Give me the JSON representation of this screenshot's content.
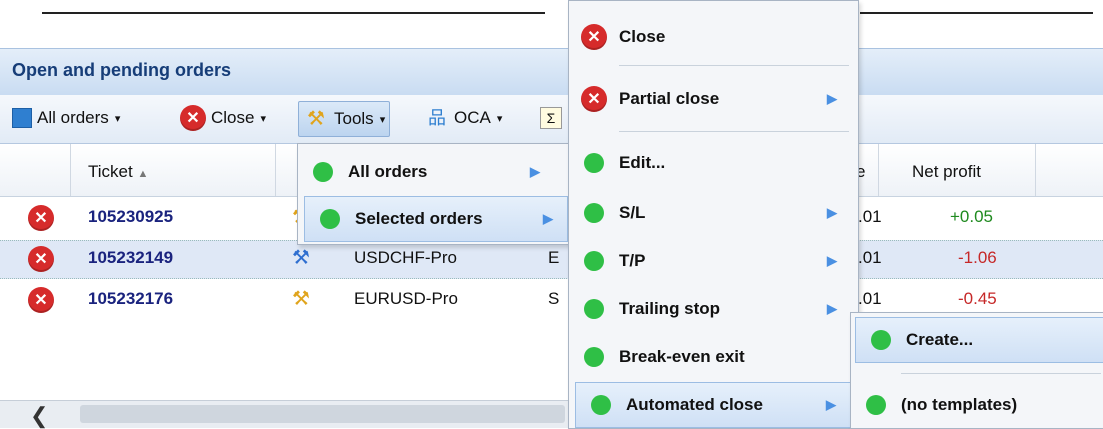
{
  "panel": {
    "title": "Open and pending orders"
  },
  "toolbar": {
    "all_orders": "All orders",
    "close": "Close",
    "tools": "Tools",
    "oca": "OCA",
    "caret": "▾"
  },
  "grid": {
    "headers": {
      "ticket": "Ticket",
      "sort_indicator": "▲",
      "net_profit": "Net profit",
      "partial_e": "e"
    },
    "rows": [
      {
        "ticket": "105230925",
        "symbol": "",
        "type": "",
        "price": ".01",
        "net_profit": "+0.05"
      },
      {
        "ticket": "105232149",
        "symbol": "USDCHF-Pro",
        "type": "E",
        "price": ".01",
        "net_profit": "-1.06"
      },
      {
        "ticket": "105232176",
        "symbol": "EURUSD-Pro",
        "type": "S",
        "price": ".01",
        "net_profit": "-0.45"
      }
    ]
  },
  "tools_menu": {
    "items": [
      {
        "label": "All orders"
      },
      {
        "label": "Selected orders"
      }
    ]
  },
  "selected_menu": {
    "items": [
      {
        "label": "Close"
      },
      {
        "label": "Partial close"
      },
      {
        "label": "Edit..."
      },
      {
        "label": "S/L"
      },
      {
        "label": "T/P"
      },
      {
        "label": "Trailing stop"
      },
      {
        "label": "Break-even exit"
      },
      {
        "label": "Automated close"
      }
    ]
  },
  "automated_menu": {
    "items": [
      {
        "label": "Create..."
      },
      {
        "label": "(no templates)"
      }
    ]
  },
  "icons": {
    "submenu_arrow": "▶",
    "close_x": "✕",
    "scroll_left": "❮",
    "tools": "⚒",
    "oca": "品",
    "sigma": "Σ"
  },
  "colors": {
    "positive": "#1f8a1f",
    "negative": "#c62828",
    "ticket": "#1a237e",
    "close_icon": "#d62b2b",
    "bullet": "#2fbf46"
  }
}
